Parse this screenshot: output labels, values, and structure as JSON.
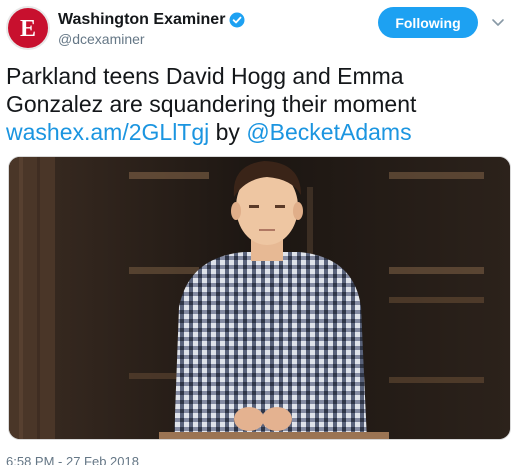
{
  "account": {
    "display_name": "Washington Examiner",
    "handle": "@dcexaminer",
    "avatar_icon": "washington-examiner-logo-icon",
    "verified_icon": "verified-badge-icon"
  },
  "actions": {
    "follow_label": "Following",
    "menu_icon": "chevron-down-icon"
  },
  "tweet": {
    "text_line1": "Parkland teens David Hogg and Emma",
    "text_line2": "Gonzalez are squandering their moment",
    "link": "washex.am/2GLlTgj",
    "by_word": " by ",
    "mention": "@BecketAdams"
  },
  "media": {
    "type": "photo"
  },
  "meta": {
    "timestamp": "6:58 PM - 27 Feb 2018"
  },
  "colors": {
    "accent": "#1da1f2",
    "link": "#1b95e0",
    "brand_red": "#c8102e"
  }
}
